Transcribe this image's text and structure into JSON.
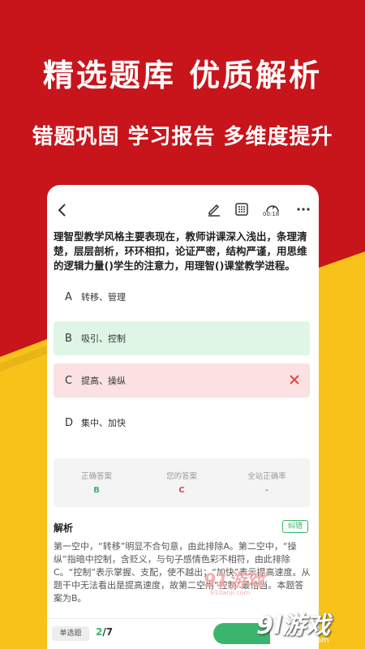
{
  "banner": {
    "headline": "精选题库 优质解析",
    "subline": "错题巩固 学习报告 多维度提升"
  },
  "toolbar": {
    "timer": "00:18"
  },
  "question": {
    "text": "理智型教学风格主要表现在，教师讲课深入浅出，条理清楚，层层剖析，环环相扣，论证严密，结构严谨，用思维的逻辑力量()学生的注意力，用理智()课堂教学进程。"
  },
  "options": [
    {
      "letter": "A",
      "text": "转移、管理",
      "state": "neutral"
    },
    {
      "letter": "B",
      "text": "吸引、控制",
      "state": "correct"
    },
    {
      "letter": "C",
      "text": "提高、操纵",
      "state": "wrong"
    },
    {
      "letter": "D",
      "text": "集中、加快",
      "state": "neutral"
    }
  ],
  "stats": {
    "correct_label": "正确答案",
    "correct_value": "B",
    "yours_label": "您的答案",
    "yours_value": "C",
    "rate_label": "全站正确率",
    "rate_value": "-"
  },
  "analysis": {
    "title": "解析",
    "error_tag": "纠错",
    "body": "第一空中，“转移”明显不合句意，由此排除A。第二空中，“操纵”指暗中控制，含贬义，与句子感情色彩不相符，由此排除C。“控制”表示掌握、支配，使不越出；“加快”表示提高速度。从题干中无法看出是提高速度，故第二空用“控制”最恰当。本题答案为B。"
  },
  "bottom": {
    "type_tag": "单选题",
    "current": "2",
    "total": "/7"
  },
  "watermark": {
    "main": "91游戏",
    "sub": "91danji.com"
  },
  "corner_logo": {
    "main": "9l游戏",
    "sub": "91danji.com"
  },
  "colors": {
    "brand_red": "#c8141b",
    "yellow": "#f7c21a",
    "correct_green": "#3ab56d",
    "wrong_red": "#e0474c"
  }
}
